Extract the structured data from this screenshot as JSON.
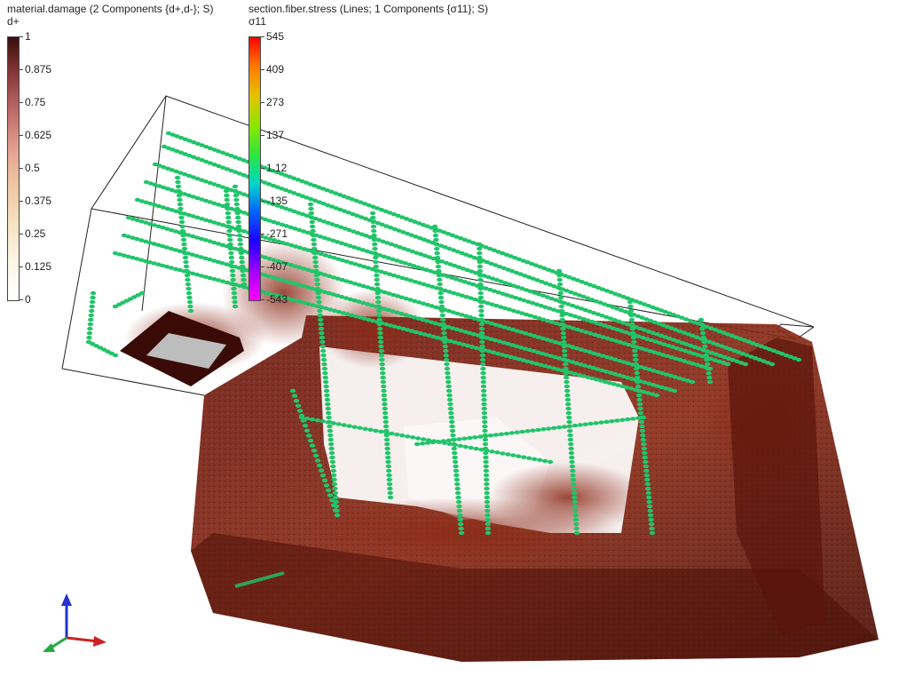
{
  "damage_legend": {
    "title": "material.damage (2 Components {d+,d-}; S)",
    "component": "d+",
    "ticks": [
      "1",
      "0.875",
      "0.75",
      "0.625",
      "0.5",
      "0.375",
      "0.25",
      "0.125",
      "0"
    ],
    "colors": [
      "#3a0d0d",
      "#8a3a3a",
      "#c06b6b",
      "#e2a190",
      "#f0c8a4",
      "#f6e4c4",
      "#fcf6e8",
      "#ffffff"
    ]
  },
  "stress_legend": {
    "title": "section.fiber.stress (Lines; 1 Components {σ11}; S)",
    "component": "σ11",
    "ticks": [
      "545",
      "409",
      "273",
      "137",
      "1.12",
      "-135",
      "-271",
      "-407",
      "-543"
    ],
    "colors": [
      "#ff0000",
      "#ff7a00",
      "#e6c200",
      "#8ee600",
      "#2fe63a",
      "#00d6c8",
      "#0060ff",
      "#2000ff",
      "#a000ff",
      "#ff00ff"
    ]
  },
  "axes_triad": {
    "x_color": "#cc2222",
    "y_color": "#22aa44",
    "z_color": "#2233cc"
  },
  "scene": {
    "damage_color": "#7a1e12",
    "rebar_color": "#22c46a"
  }
}
